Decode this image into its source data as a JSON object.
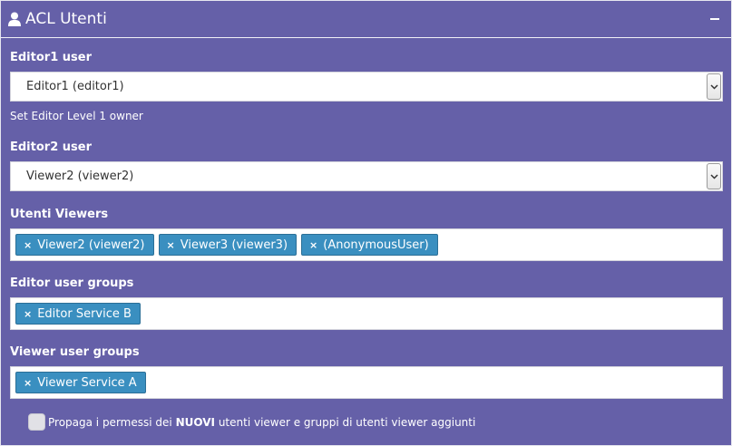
{
  "panel": {
    "title": "ACL Utenti",
    "icon": "user-icon",
    "collapse_icon": "minus-icon"
  },
  "editor1": {
    "label": "Editor1 user",
    "value": "Editor1 (editor1)",
    "help": "Set Editor Level 1 owner"
  },
  "editor2": {
    "label": "Editor2 user",
    "value": "Viewer2 (viewer2)"
  },
  "viewers": {
    "label": "Utenti Viewers",
    "tags": [
      "Viewer2 (viewer2)",
      "Viewer3 (viewer3)",
      "(AnonymousUser)"
    ]
  },
  "editor_groups": {
    "label": "Editor user groups",
    "tags": [
      "Editor Service B"
    ]
  },
  "viewer_groups": {
    "label": "Viewer user groups",
    "tags": [
      "Viewer Service A"
    ]
  },
  "propagate": {
    "prefix": "Propaga i permessi dei",
    "bold": "NUOVI",
    "suffix": "utenti viewer e gruppi di utenti viewer aggiunti",
    "checked": false
  },
  "tag_remove_symbol": "×",
  "colors": {
    "panel_bg": "#6560a8",
    "tag_bg": "#3a8fc0"
  }
}
